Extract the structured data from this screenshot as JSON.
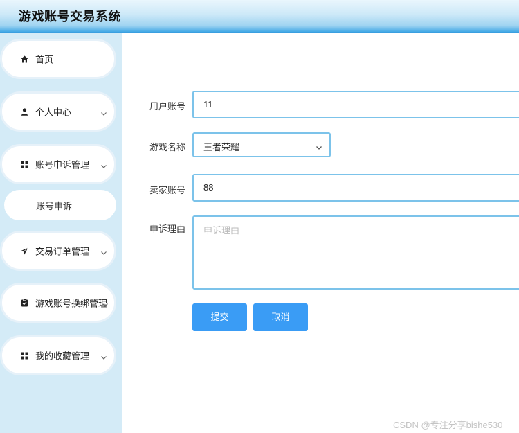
{
  "app": {
    "title": "游戏账号交易系统"
  },
  "sidebar": {
    "items": [
      {
        "label": "首页",
        "icon": "home-icon"
      },
      {
        "label": "个人中心",
        "icon": "user-icon"
      },
      {
        "label": "账号申诉管理",
        "icon": "grid-icon"
      },
      {
        "label": "交易订单管理",
        "icon": "send-icon"
      },
      {
        "label": "游戏账号换绑管理",
        "icon": "clipboard-icon"
      },
      {
        "label": "我的收藏管理",
        "icon": "grid-icon"
      }
    ],
    "submenu": {
      "label": "账号申诉"
    }
  },
  "form": {
    "user_account_label": "用户账号",
    "user_account_value": "11",
    "game_name_label": "游戏名称",
    "game_name_value": "王者荣耀",
    "seller_account_label": "卖家账号",
    "seller_account_value": "88",
    "reason_label": "申诉理由",
    "reason_placeholder": "申诉理由",
    "submit_label": "提交",
    "cancel_label": "取消"
  },
  "watermark": "CSDN @专注分享bishe530",
  "colors": {
    "accent": "#3a9cf5",
    "sidebar_bg": "#d4ebf7",
    "input_border": "#7cc3ea"
  }
}
